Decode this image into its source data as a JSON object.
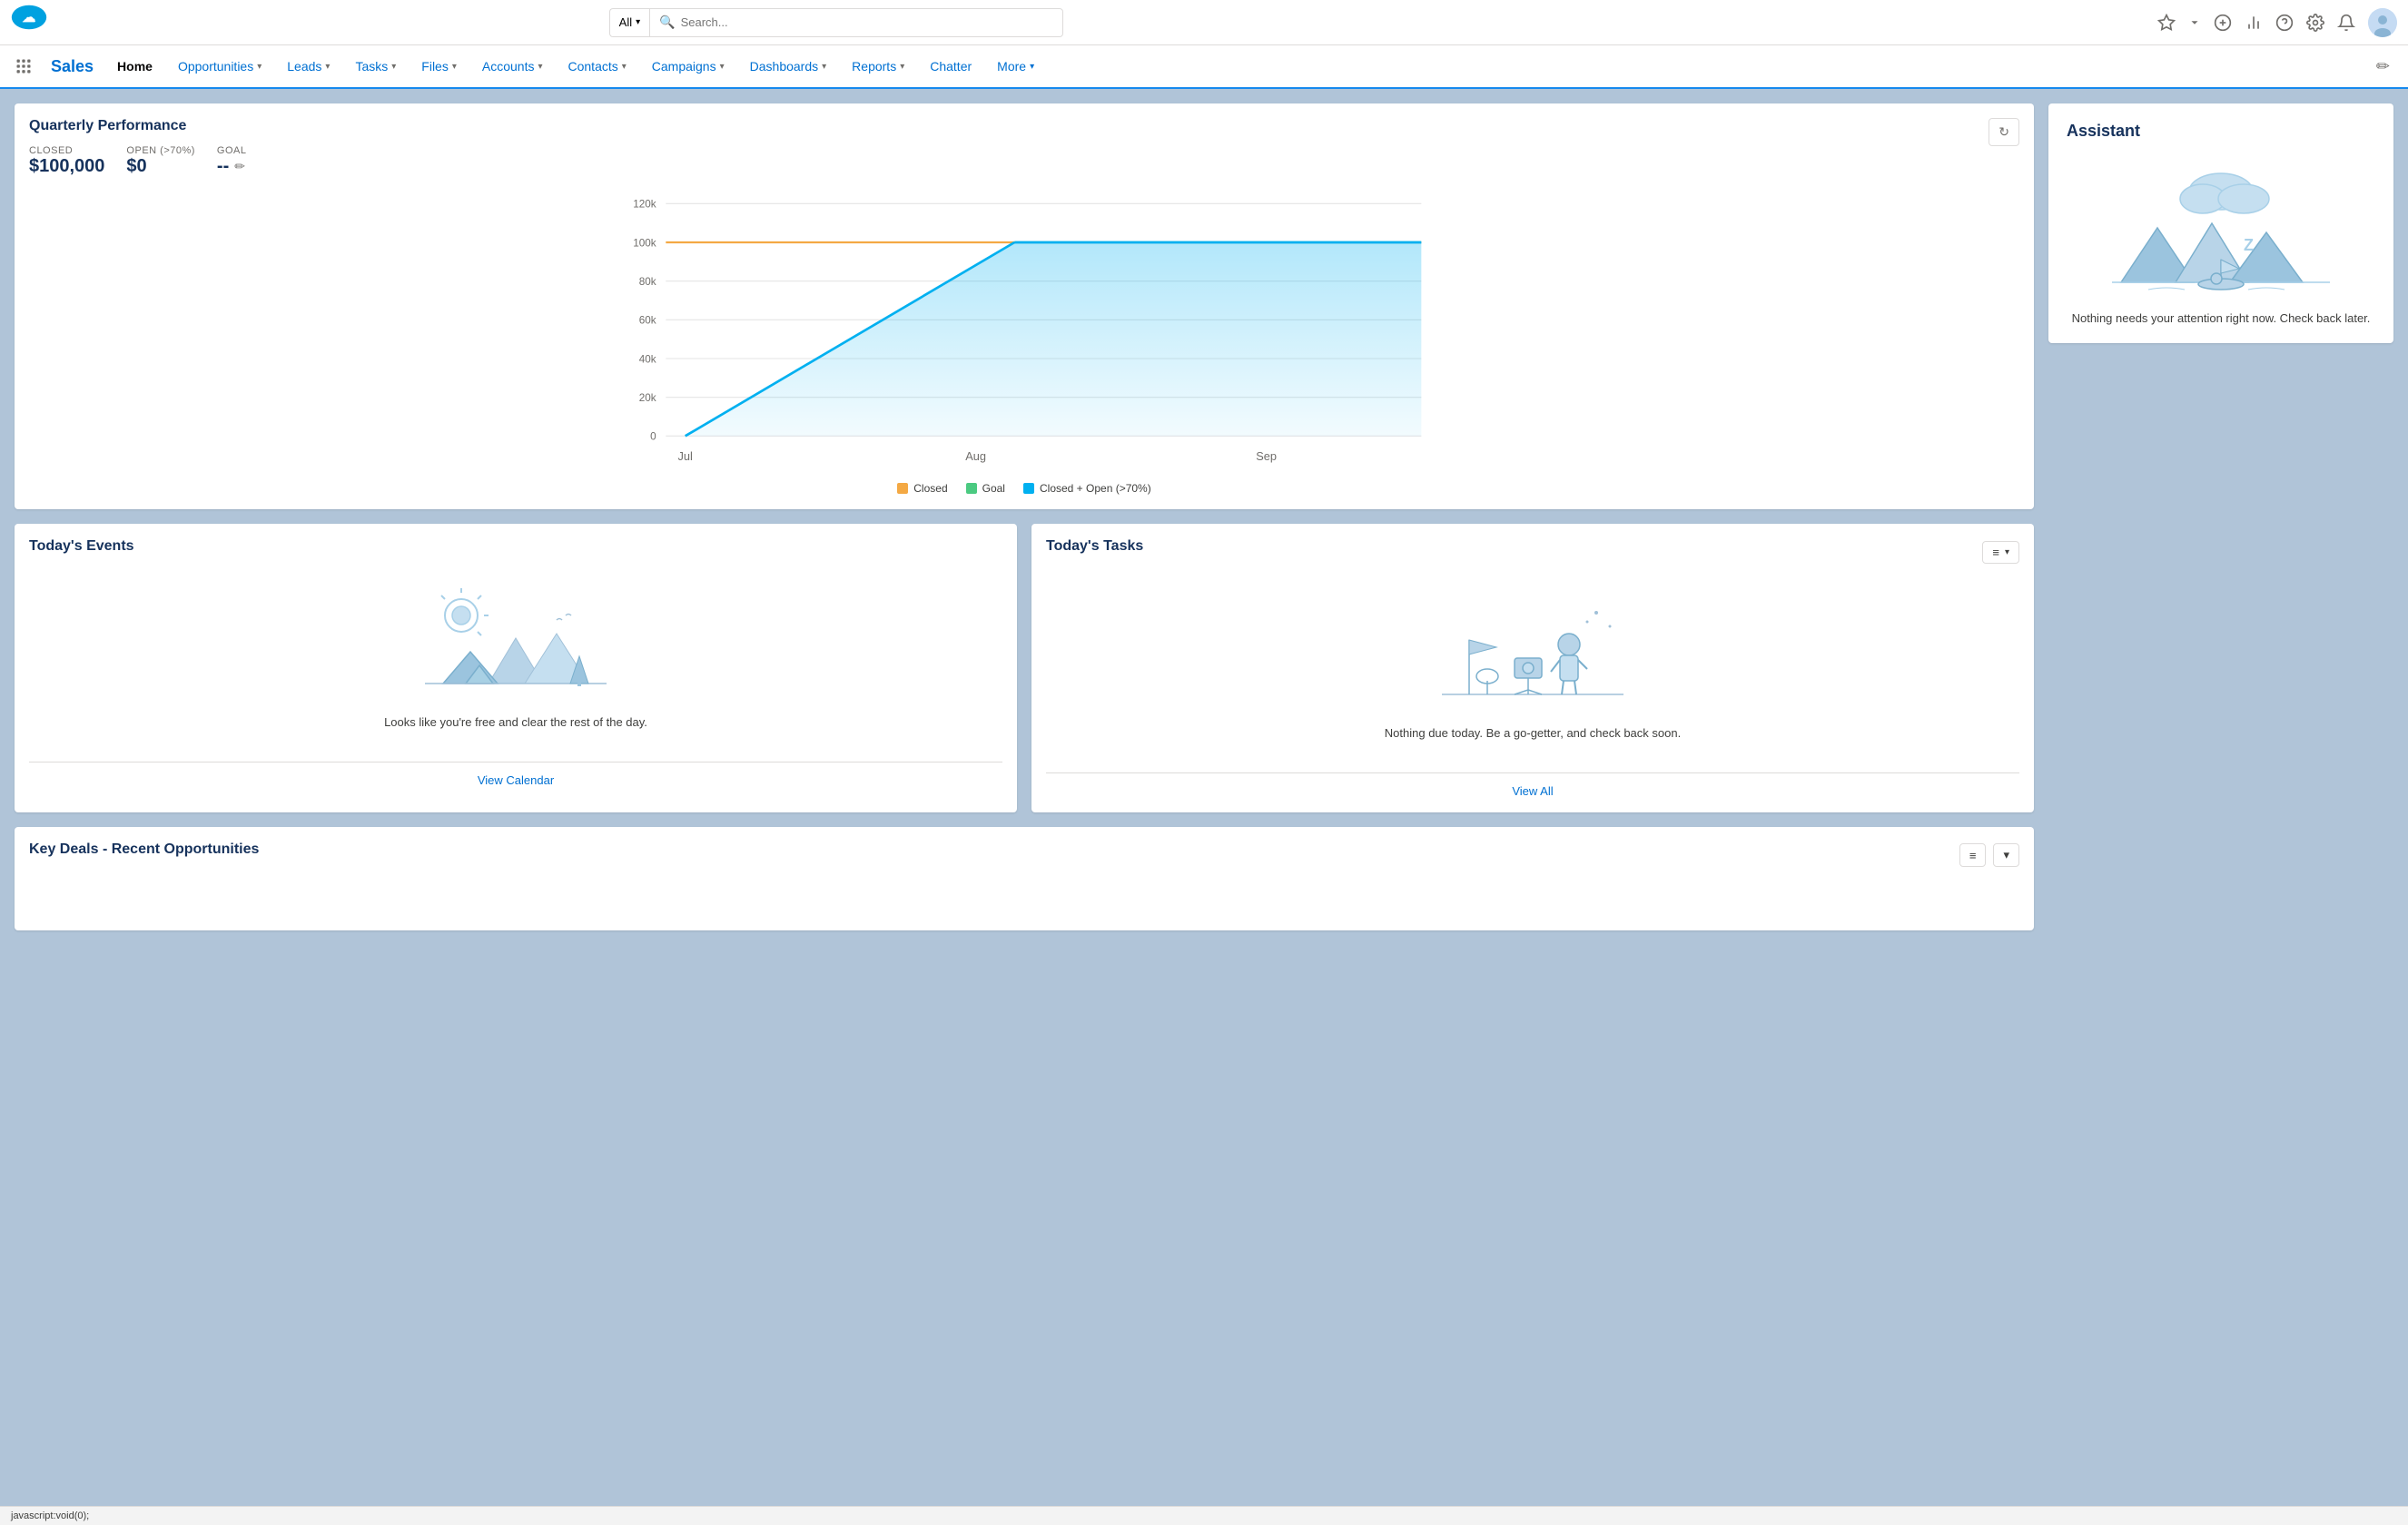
{
  "app": {
    "name": "Sales",
    "logo_alt": "Salesforce"
  },
  "search": {
    "scope": "All",
    "placeholder": "Search..."
  },
  "nav": {
    "items": [
      {
        "label": "Home",
        "active": true,
        "has_dropdown": false
      },
      {
        "label": "Opportunities",
        "active": false,
        "has_dropdown": true
      },
      {
        "label": "Leads",
        "active": false,
        "has_dropdown": true
      },
      {
        "label": "Tasks",
        "active": false,
        "has_dropdown": true
      },
      {
        "label": "Files",
        "active": false,
        "has_dropdown": true
      },
      {
        "label": "Accounts",
        "active": false,
        "has_dropdown": true
      },
      {
        "label": "Contacts",
        "active": false,
        "has_dropdown": true
      },
      {
        "label": "Campaigns",
        "active": false,
        "has_dropdown": true
      },
      {
        "label": "Dashboards",
        "active": false,
        "has_dropdown": true
      },
      {
        "label": "Reports",
        "active": false,
        "has_dropdown": true
      },
      {
        "label": "Chatter",
        "active": false,
        "has_dropdown": false
      }
    ],
    "more_label": "More",
    "edit_icon": "✏"
  },
  "quarterly_performance": {
    "title": "Quarterly Performance",
    "closed_label": "CLOSED",
    "closed_value": "$100,000",
    "open_label": "OPEN (>70%)",
    "open_value": "$0",
    "goal_label": "GOAL",
    "goal_value": "--",
    "chart": {
      "x_labels": [
        "Jul",
        "Aug",
        "Sep"
      ],
      "y_labels": [
        "120k",
        "100k",
        "80k",
        "60k",
        "40k",
        "20k",
        "0"
      ],
      "y_values": [
        120000,
        100000,
        80000,
        60000,
        40000,
        20000,
        0
      ]
    },
    "legend": [
      {
        "label": "Closed",
        "color": "#f4a944"
      },
      {
        "label": "Goal",
        "color": "#4bca81"
      },
      {
        "label": "Closed + Open (>70%)",
        "color": "#00b0f0"
      }
    ],
    "refresh_icon": "↻"
  },
  "todays_events": {
    "title": "Today's Events",
    "empty_text": "Looks like you're free and clear the rest of the day.",
    "view_link": "View Calendar"
  },
  "todays_tasks": {
    "title": "Today's Tasks",
    "empty_text": "Nothing due today. Be a go-getter, and check back soon.",
    "view_link": "View All",
    "filter_icon": "≡"
  },
  "key_deals": {
    "title": "Key Deals - Recent Opportunities"
  },
  "assistant": {
    "title": "Assistant",
    "empty_text": "Nothing needs your attention right now. Check back later."
  },
  "status_bar": {
    "text": "javascript:void(0);"
  }
}
